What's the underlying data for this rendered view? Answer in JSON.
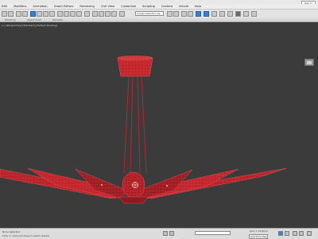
{
  "titlebar": {
    "signin": "Sign In"
  },
  "menu": {
    "items": [
      "Edit",
      "Modifiers",
      "Animation",
      "Graph Editors",
      "Rendering",
      "Civil View",
      "Customize",
      "Scripting",
      "Content",
      "Arnold",
      "Help"
    ]
  },
  "toolbar": {
    "dropdown": "Create Selection Se"
  },
  "subtoolbar": {
    "items": [
      "Modeling",
      "Object Paint",
      "Populate"
    ]
  },
  "viewport": {
    "label": "[+] [Perspective] [Standard] [Default Shading]"
  },
  "status": {
    "selection": "None Selected",
    "hint": "Click or click-and-drag to select objects",
    "coord_label": "Grid = 10.0mm",
    "add_time_tag": "Add Time Tag"
  },
  "colors": {
    "model": "#c0262b",
    "wire": "#f05a60",
    "background": "#3b3b3b"
  }
}
